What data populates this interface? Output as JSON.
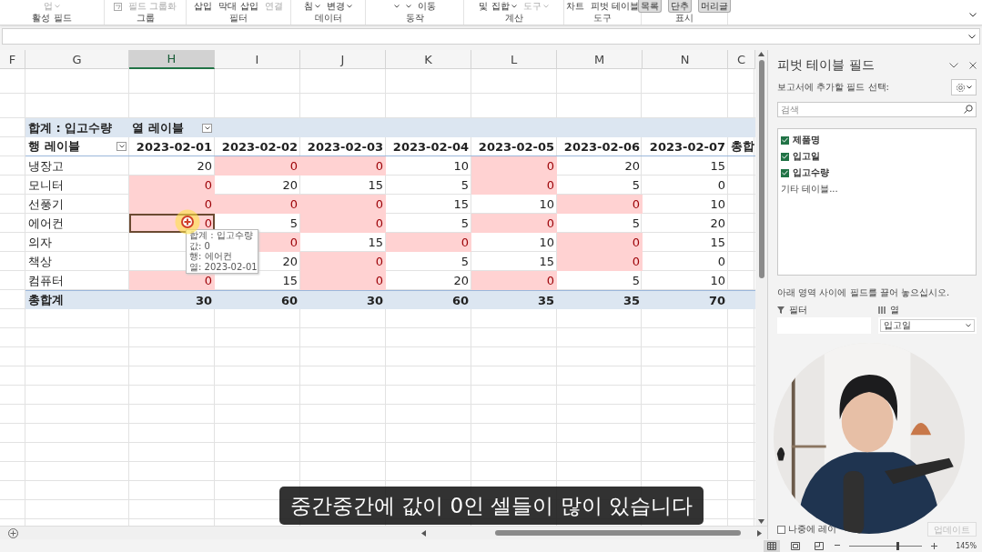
{
  "ribbon": {
    "groups": [
      {
        "label": "활성 필드",
        "items": [
          {
            "kind": "command",
            "text": "업",
            "disabled": true,
            "dropdown": true
          }
        ]
      },
      {
        "label": "그룹",
        "items": [
          {
            "kind": "icon-command",
            "text": "필드 그룹화",
            "disabled": true,
            "dropdown": false
          }
        ]
      },
      {
        "label": "필터",
        "items": [
          {
            "kind": "command",
            "text": "삽입",
            "disabled": false,
            "dropdown": false
          },
          {
            "kind": "command",
            "text": "막대 삽입",
            "disabled": false,
            "dropdown": false
          },
          {
            "kind": "command",
            "text": "연결",
            "disabled": true,
            "dropdown": false
          }
        ]
      },
      {
        "label": "데이터",
        "items": [
          {
            "kind": "command",
            "text": "침",
            "disabled": false,
            "dropdown": true
          },
          {
            "kind": "command",
            "text": "변경",
            "disabled": false,
            "dropdown": true
          }
        ]
      },
      {
        "label": "동작",
        "items": [
          {
            "kind": "caret"
          },
          {
            "kind": "caret"
          },
          {
            "kind": "command",
            "text": "이동",
            "disabled": false,
            "dropdown": false
          }
        ]
      },
      {
        "label": "계산",
        "items": [
          {
            "kind": "command",
            "text": "및 집합",
            "disabled": false,
            "dropdown": true
          },
          {
            "kind": "command",
            "text": "도구",
            "disabled": true,
            "dropdown": true
          }
        ]
      },
      {
        "label": "도구",
        "items": [
          {
            "kind": "command",
            "text": "차트",
            "disabled": false,
            "dropdown": false
          },
          {
            "kind": "command",
            "text": "피벗 테이블",
            "disabled": false,
            "dropdown": false
          }
        ]
      },
      {
        "label": "표시",
        "items": [
          {
            "kind": "toggle",
            "text": "목록",
            "selected": true
          },
          {
            "kind": "toggle",
            "text": "단추",
            "selected": true
          },
          {
            "kind": "toggle",
            "text": "머리글",
            "selected": true
          }
        ]
      }
    ]
  },
  "columns": [
    {
      "letter": "F",
      "selected": false
    },
    {
      "letter": "G",
      "selected": false
    },
    {
      "letter": "H",
      "selected": true
    },
    {
      "letter": "I",
      "selected": false
    },
    {
      "letter": "J",
      "selected": false
    },
    {
      "letter": "K",
      "selected": false
    },
    {
      "letter": "L",
      "selected": false
    },
    {
      "letter": "M",
      "selected": false
    },
    {
      "letter": "N",
      "selected": false
    },
    {
      "letter": "C",
      "selected": false
    }
  ],
  "pivot": {
    "corner": "합계 : 입고수량",
    "column_labels": "열 레이블",
    "row_labels": "행 레이블",
    "dates": [
      "2023-02-01",
      "2023-02-02",
      "2023-02-03",
      "2023-02-04",
      "2023-02-05",
      "2023-02-06",
      "2023-02-07"
    ],
    "grand_total_header": "총합",
    "rows": [
      {
        "label": "냉장고",
        "cells": [
          {
            "value": "20",
            "highlight": false,
            "selected": false
          },
          {
            "value": "0",
            "highlight": true,
            "selected": false
          },
          {
            "value": "0",
            "highlight": true,
            "selected": false
          },
          {
            "value": "10",
            "highlight": false,
            "selected": false
          },
          {
            "value": "0",
            "highlight": true,
            "selected": false
          },
          {
            "value": "20",
            "highlight": false,
            "selected": false
          },
          {
            "value": "15",
            "highlight": false,
            "selected": false
          }
        ]
      },
      {
        "label": "모니터",
        "cells": [
          {
            "value": "0",
            "highlight": true,
            "selected": false
          },
          {
            "value": "20",
            "highlight": false,
            "selected": false
          },
          {
            "value": "15",
            "highlight": false,
            "selected": false
          },
          {
            "value": "5",
            "highlight": false,
            "selected": false
          },
          {
            "value": "0",
            "highlight": true,
            "selected": false
          },
          {
            "value": "5",
            "highlight": false,
            "selected": false
          },
          {
            "value": "0",
            "highlight": false,
            "selected": false
          }
        ]
      },
      {
        "label": "선풍기",
        "cells": [
          {
            "value": "0",
            "highlight": true,
            "selected": false
          },
          {
            "value": "0",
            "highlight": true,
            "selected": false
          },
          {
            "value": "0",
            "highlight": true,
            "selected": false
          },
          {
            "value": "15",
            "highlight": false,
            "selected": false
          },
          {
            "value": "10",
            "highlight": false,
            "selected": false
          },
          {
            "value": "0",
            "highlight": true,
            "selected": false
          },
          {
            "value": "10",
            "highlight": false,
            "selected": false
          }
        ]
      },
      {
        "label": "에어컨",
        "cells": [
          {
            "value": "0",
            "highlight": true,
            "selected": true
          },
          {
            "value": "5",
            "highlight": false,
            "selected": false
          },
          {
            "value": "0",
            "highlight": true,
            "selected": false
          },
          {
            "value": "5",
            "highlight": false,
            "selected": false
          },
          {
            "value": "0",
            "highlight": true,
            "selected": false
          },
          {
            "value": "5",
            "highlight": false,
            "selected": false
          },
          {
            "value": "20",
            "highlight": false,
            "selected": false
          }
        ]
      },
      {
        "label": "의자",
        "cells": [
          null,
          {
            "value": "0",
            "highlight": true,
            "selected": false
          },
          {
            "value": "15",
            "highlight": false,
            "selected": false
          },
          {
            "value": "0",
            "highlight": true,
            "selected": false
          },
          {
            "value": "10",
            "highlight": false,
            "selected": false
          },
          {
            "value": "0",
            "highlight": true,
            "selected": false
          },
          {
            "value": "15",
            "highlight": false,
            "selected": false
          }
        ]
      },
      {
        "label": "책상",
        "cells": [
          null,
          {
            "value": "20",
            "highlight": false,
            "selected": false
          },
          {
            "value": "0",
            "highlight": true,
            "selected": false
          },
          {
            "value": "5",
            "highlight": false,
            "selected": false
          },
          {
            "value": "15",
            "highlight": false,
            "selected": false
          },
          {
            "value": "0",
            "highlight": true,
            "selected": false
          },
          {
            "value": "0",
            "highlight": false,
            "selected": false
          }
        ]
      },
      {
        "label": "컴퓨터",
        "cells": [
          {
            "value": "0",
            "highlight": true,
            "selected": false
          },
          {
            "value": "15",
            "highlight": false,
            "selected": false
          },
          {
            "value": "0",
            "highlight": true,
            "selected": false
          },
          {
            "value": "20",
            "highlight": false,
            "selected": false
          },
          {
            "value": "0",
            "highlight": true,
            "selected": false
          },
          {
            "value": "5",
            "highlight": false,
            "selected": false
          },
          {
            "value": "10",
            "highlight": false,
            "selected": false
          }
        ]
      }
    ],
    "total": {
      "label": "총합계",
      "values": [
        "30",
        "60",
        "30",
        "60",
        "35",
        "35",
        "70"
      ]
    }
  },
  "tooltip": {
    "lines": [
      "합계 : 입고수량",
      "값: 0",
      "행: 에어컨",
      "열: 2023-02-01"
    ]
  },
  "field_panel": {
    "title": "피벗 테이블 필드",
    "prompt": "보고서에 추가할 필드 선택:",
    "search": {
      "placeholder": "검색"
    },
    "fields": [
      {
        "name": "제품명",
        "checked": true
      },
      {
        "name": "입고일",
        "checked": true
      },
      {
        "name": "입고수량",
        "checked": true
      }
    ],
    "more_tables": "기타 테이블...",
    "drag_hint": "아래 영역 사이에 필드를 끌어 놓으십시오.",
    "areas": [
      {
        "kind": "filter",
        "label": "필터"
      },
      {
        "kind": "columns",
        "label": "열",
        "items": [
          "입고일"
        ]
      }
    ],
    "defer_update": {
      "label": "나중에 레이",
      "checked": false
    },
    "update_button": {
      "label": "업데이트",
      "disabled": true
    }
  },
  "status_bar": {
    "views": [
      {
        "kind": "normal",
        "selected": true
      },
      {
        "kind": "page-layout",
        "selected": false
      },
      {
        "kind": "page-break",
        "selected": false
      }
    ],
    "zoom": {
      "level": 0.65,
      "reading": "145%"
    }
  },
  "caption": "중간중간에 값이 0인 셀들이 많이 있습니다"
}
